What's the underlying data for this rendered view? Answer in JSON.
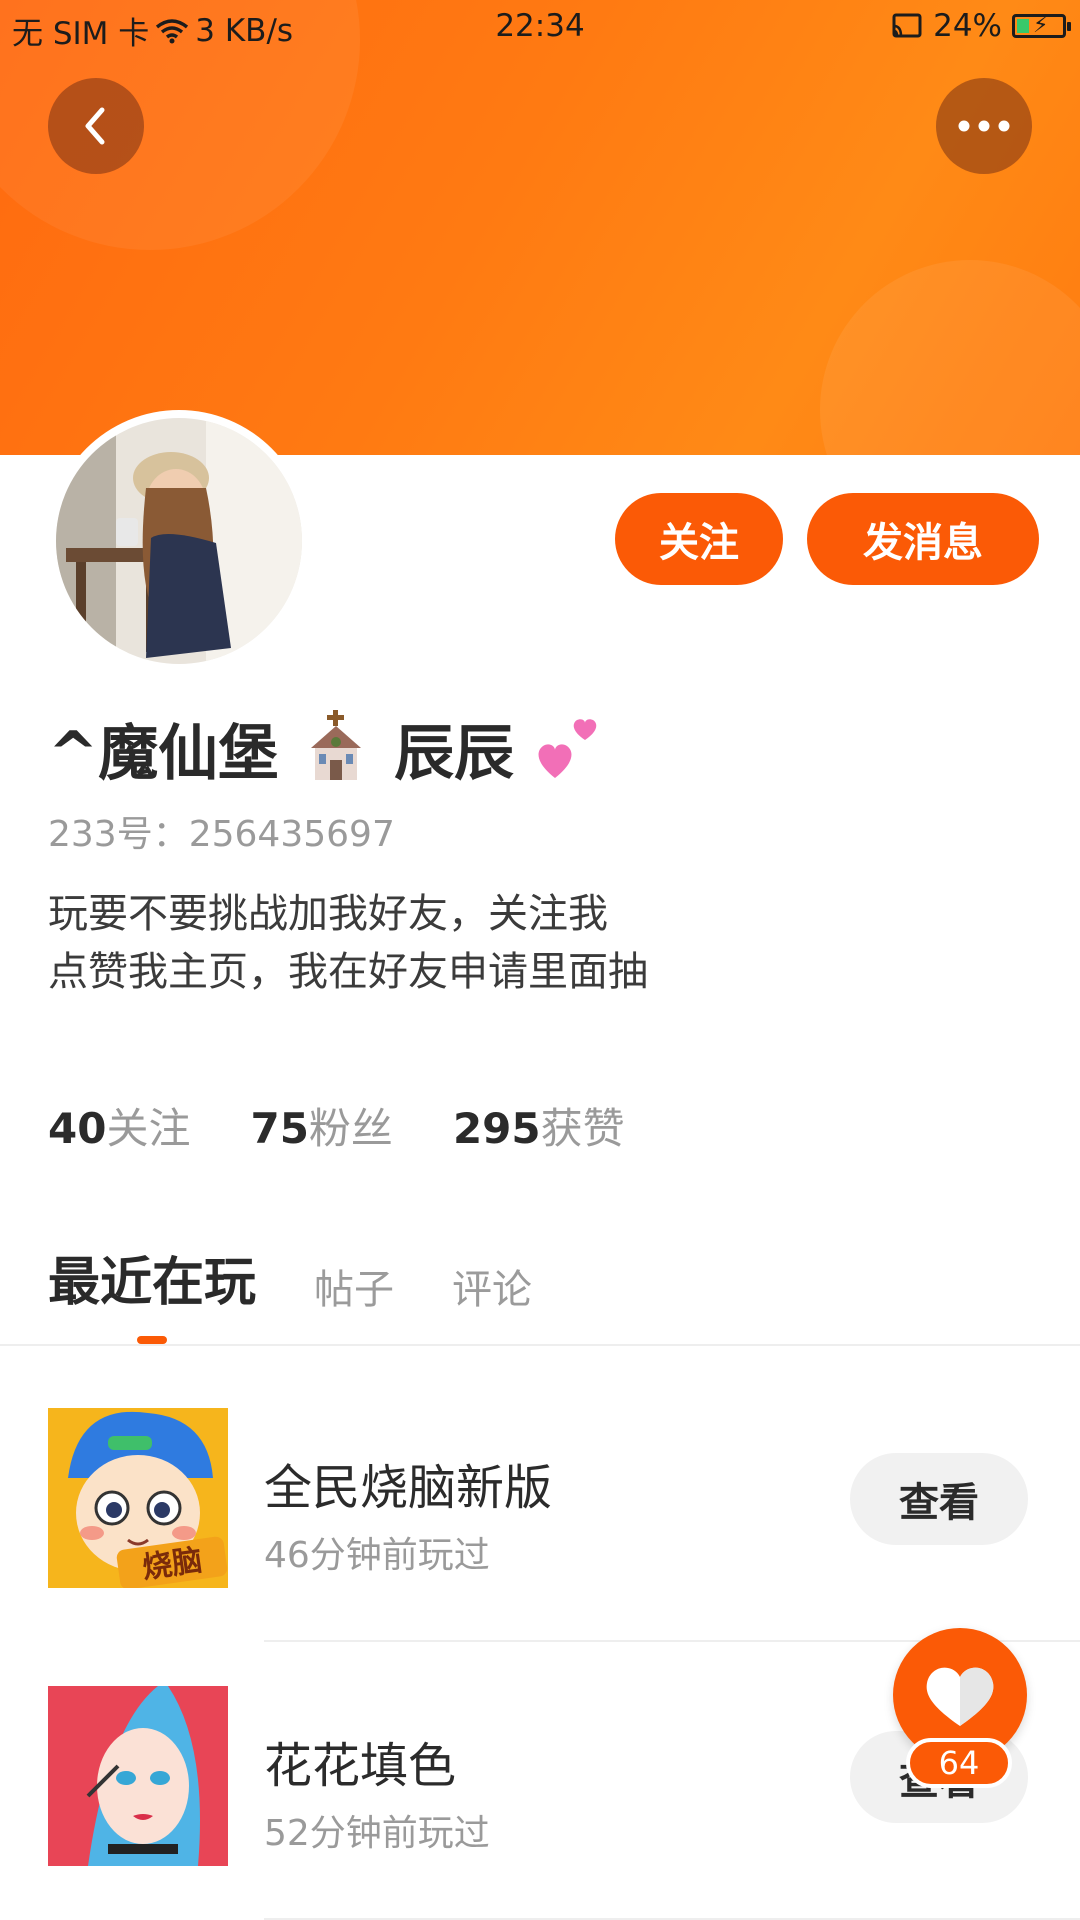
{
  "status_bar": {
    "carrier": "无 SIM 卡",
    "speed": "3 KB/s",
    "time": "22:34",
    "battery": "24%"
  },
  "colors": {
    "accent": "#fb5a06",
    "banner": "#ff7a12"
  },
  "nav": {
    "back_icon": "chevron-left-icon",
    "more_icon": "more-dots-icon"
  },
  "profile": {
    "name_prefix": "^魔仙堡",
    "name_suffix": "辰辰",
    "uid": "233号：256435697",
    "bio_line1": "玩要不要挑战加我好友，关注我",
    "bio_line2": "点赞我主页，我在好友申请里面抽"
  },
  "actions": {
    "follow": "关注",
    "message": "发消息"
  },
  "stats": [
    {
      "num": "40",
      "label": "关注"
    },
    {
      "num": "75",
      "label": "粉丝"
    },
    {
      "num": "295",
      "label": "获赞"
    }
  ],
  "tabs": [
    {
      "label": "最近在玩",
      "active": true
    },
    {
      "label": "帖子",
      "active": false
    },
    {
      "label": "评论",
      "active": false
    }
  ],
  "games": [
    {
      "title": "全民烧脑新版",
      "subtitle": "46分钟前玩过",
      "action": "查看",
      "icon_text": "烧脑"
    },
    {
      "title": "花花填色",
      "subtitle": "52分钟前玩过",
      "action": "查看"
    }
  ],
  "like": {
    "count": "64"
  }
}
